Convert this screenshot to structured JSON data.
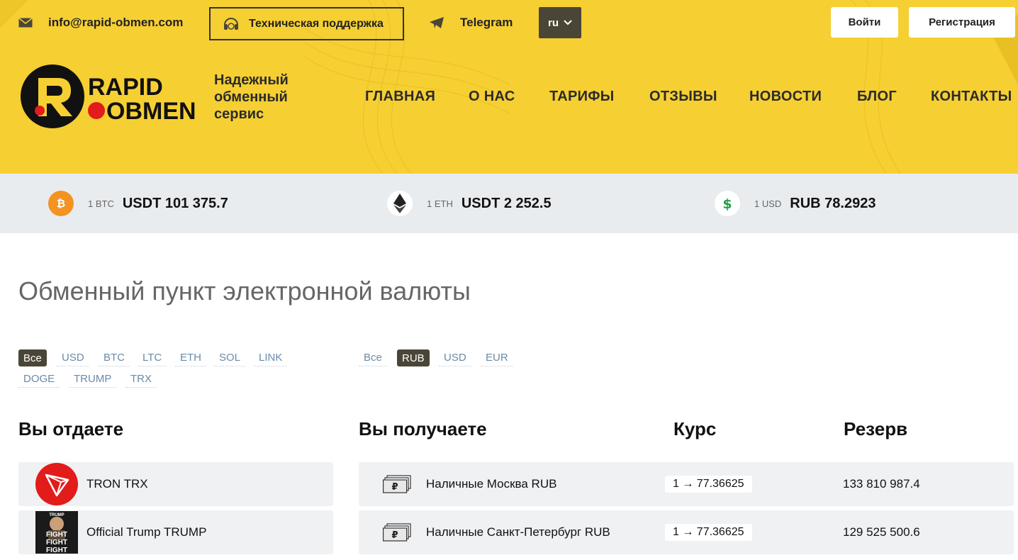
{
  "topbar": {
    "email": "info@rapid-obmen.com",
    "support": "Техническая поддержка",
    "telegram": "Telegram",
    "lang": "ru",
    "login": "Войти",
    "register": "Регистрация"
  },
  "brand": {
    "logo_text_1": "RAPID",
    "logo_text_2": "OBMEN",
    "tagline": "Надежный обменный сервис"
  },
  "nav": [
    "ГЛАВНАЯ",
    "О НАС",
    "ТАРИФЫ",
    "ОТЗЫВЫ",
    "НОВОСТИ",
    "БЛОГ",
    "КОНТАКТЫ"
  ],
  "rates": [
    {
      "icon": "bitcoin-icon",
      "unit": "1 BTC",
      "value": "USDT 101 375.7"
    },
    {
      "icon": "ethereum-icon",
      "unit": "1 ETH",
      "value": "USDT 2 252.5"
    },
    {
      "icon": "dollar-icon",
      "unit": "1 USD",
      "value": "RUB 78.2923"
    }
  ],
  "page_title": "Обменный пункт электронной валюты",
  "give_filters": [
    "Все",
    "USD",
    "BTC",
    "LTC",
    "ETH",
    "SOL",
    "LINK",
    "DOGE",
    "TRUMP",
    "TRX"
  ],
  "give_filter_active": "Все",
  "get_filters": [
    "Все",
    "RUB",
    "USD",
    "EUR"
  ],
  "get_filter_active": "RUB",
  "columns": {
    "give": "Вы отдаете",
    "get": "Вы получаете",
    "rate": "Курс",
    "reserve": "Резерв"
  },
  "give_rows": [
    {
      "name": "TRON TRX",
      "icon": "tron-icon"
    },
    {
      "name": "Official Trump TRUMP",
      "icon": "trump-token-icon"
    }
  ],
  "get_rows": [
    {
      "name": "Наличные Москва RUB",
      "rate": "1 → 77.36625",
      "reserve": "133 810 987.4"
    },
    {
      "name": "Наличные Санкт-Петербург RUB",
      "rate": "1 → 77.36625",
      "reserve": "129 525 500.6"
    }
  ],
  "colors": {
    "header_bg": "#f6cf33",
    "rates_bg": "#e9ecee",
    "dark_accent": "#4a4537",
    "brand_red": "#e21b1b",
    "link": "#6a8aa8"
  }
}
